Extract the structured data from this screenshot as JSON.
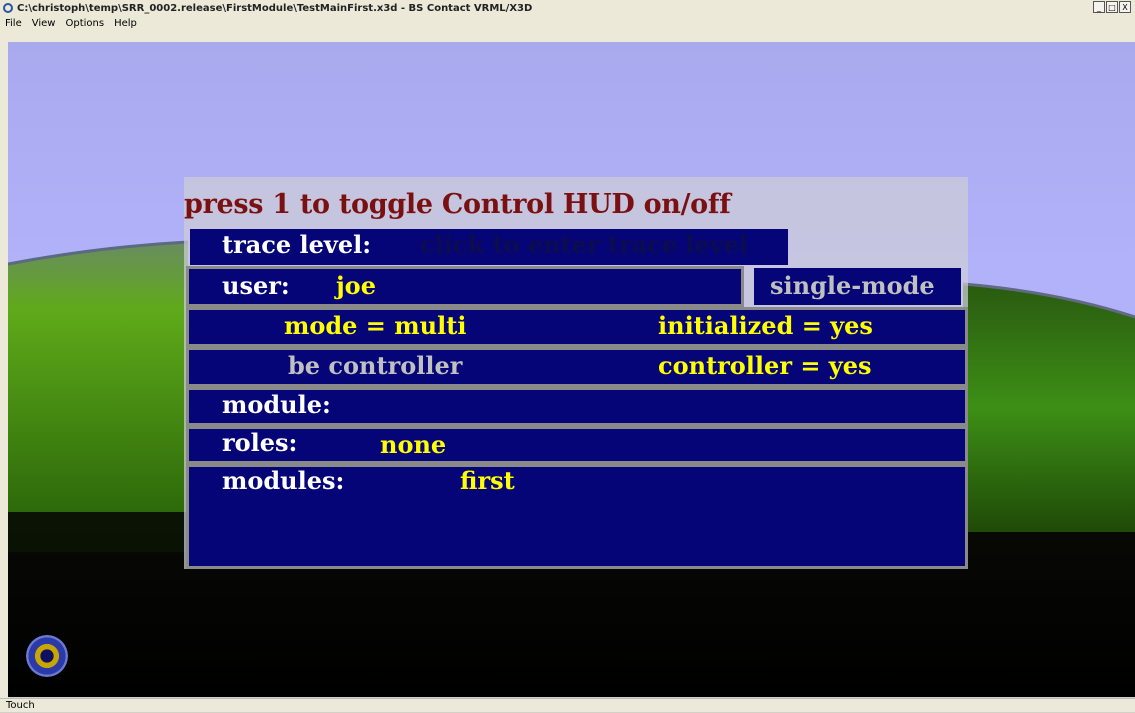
{
  "window": {
    "title": "C:\\christoph\\temp\\SRR_0002.release\\FirstModule\\TestMainFirst.x3d - BS Contact VRML/X3D",
    "minimize": "_",
    "maximize": "□",
    "close": "X"
  },
  "menu": [
    "File",
    "View",
    "Options",
    "Help"
  ],
  "hud": {
    "title": "press 1 to toggle Control HUD on/off",
    "trace_label": "trace level:",
    "trace_prompt": "click to enter trace level",
    "user_label": "user:",
    "user_value": "joe",
    "single_mode_button": "single-mode",
    "mode": "mode = multi",
    "initialized": "initialized = yes",
    "be_controller_button": "be controller",
    "controller": "controller = yes",
    "module_label": "module:",
    "roles_label": "roles:",
    "roles_value": "none",
    "modules_label": "modules:",
    "modules_value": "first"
  },
  "status": {
    "text": "Touch"
  },
  "colors": {
    "hud_panel": "#050578",
    "hud_title": "#7a1010",
    "value_yellow": "#ffff00",
    "sky": "#b2b2fb",
    "ground": "#3f8a12"
  },
  "icons": {
    "navigation": "navigation-orb-icon",
    "app": "app-icon"
  }
}
